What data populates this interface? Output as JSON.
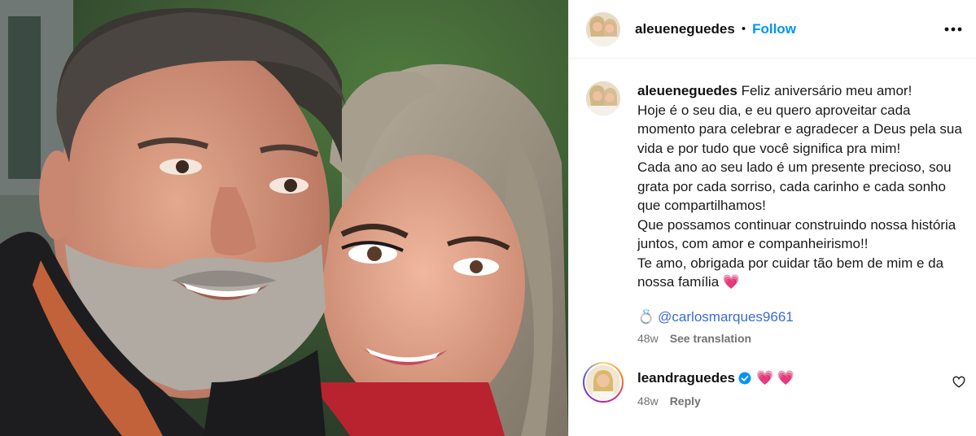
{
  "post": {
    "username": "aleueneguedes",
    "follow_label": "Follow",
    "separator": "•",
    "more_icon": "more-horizontal-icon"
  },
  "caption": {
    "username": "aleueneguedes",
    "first_line": "Feliz aniversário meu amor!",
    "lines": [
      "Hoje é o seu dia, e eu quero aproveitar cada",
      "momento para celebrar e agradecer a Deus pela sua",
      "vida e por tudo que você significa pra mim!",
      "Cada ano ao seu lado é um presente precioso, sou",
      "grata por cada sorriso, cada carinho e cada sonho",
      "que compartilhamos!",
      "Que possamos continuar construindo nossa história",
      "juntos, com amor e companheirismo!!",
      "Te amo, obrigada por cuidar tão bem de mim e da",
      "nossa família 💗"
    ],
    "tag_emoji": "💍",
    "tag": "@carlosmarques9661",
    "age": "48w",
    "see_translation": "See translation"
  },
  "comment": {
    "username": "leandraguedes",
    "text": "💗 💗",
    "age": "48w",
    "reply_label": "Reply"
  },
  "colors": {
    "follow": "#0095f6",
    "verified": "#0095f6",
    "muted": "#737373"
  }
}
